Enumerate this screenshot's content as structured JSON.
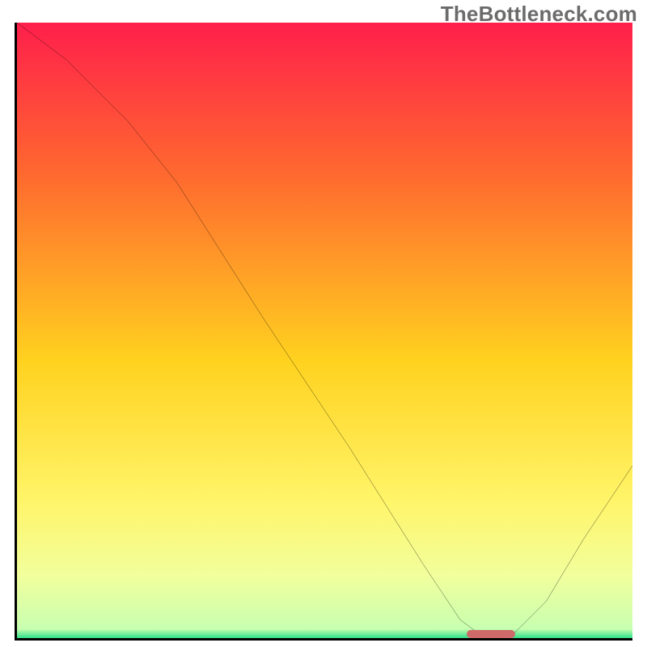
{
  "watermark": "TheBottleneck.com",
  "colors": {
    "gradient_top": "#ff1f4b",
    "gradient_mid1": "#ff6a2f",
    "gradient_mid2": "#ffd21f",
    "gradient_mid3": "#fff56a",
    "gradient_mid4": "#f1ff9d",
    "gradient_bottom_edge": "#2fe08a",
    "curve": "#000000",
    "axis": "#000000",
    "marker": "#cf6a6a"
  },
  "chart_data": {
    "type": "line",
    "title": "",
    "xlabel": "",
    "ylabel": "",
    "xlim": [
      0,
      100
    ],
    "ylim": [
      0,
      100
    ],
    "grid": false,
    "legend": false,
    "series": [
      {
        "name": "bottleneck-curve",
        "x": [
          0,
          8,
          18,
          26,
          40,
          54,
          66,
          72,
          76,
          80,
          86,
          92,
          100
        ],
        "values": [
          100,
          94,
          84,
          74,
          52,
          31,
          12,
          3,
          0,
          0,
          6,
          16,
          28
        ]
      }
    ],
    "annotations": [
      {
        "name": "optimal-marker",
        "x_start": 73,
        "x_end": 81,
        "y": 0
      }
    ],
    "background": {
      "type": "vertical-gradient",
      "stops": [
        {
          "offset": 0.0,
          "color": "#ff1f4b"
        },
        {
          "offset": 0.25,
          "color": "#ff6a2f"
        },
        {
          "offset": 0.55,
          "color": "#ffd21f"
        },
        {
          "offset": 0.78,
          "color": "#fff56a"
        },
        {
          "offset": 0.9,
          "color": "#f1ff9d"
        },
        {
          "offset": 0.985,
          "color": "#c8ffb0"
        },
        {
          "offset": 1.0,
          "color": "#2fe08a"
        }
      ]
    }
  }
}
